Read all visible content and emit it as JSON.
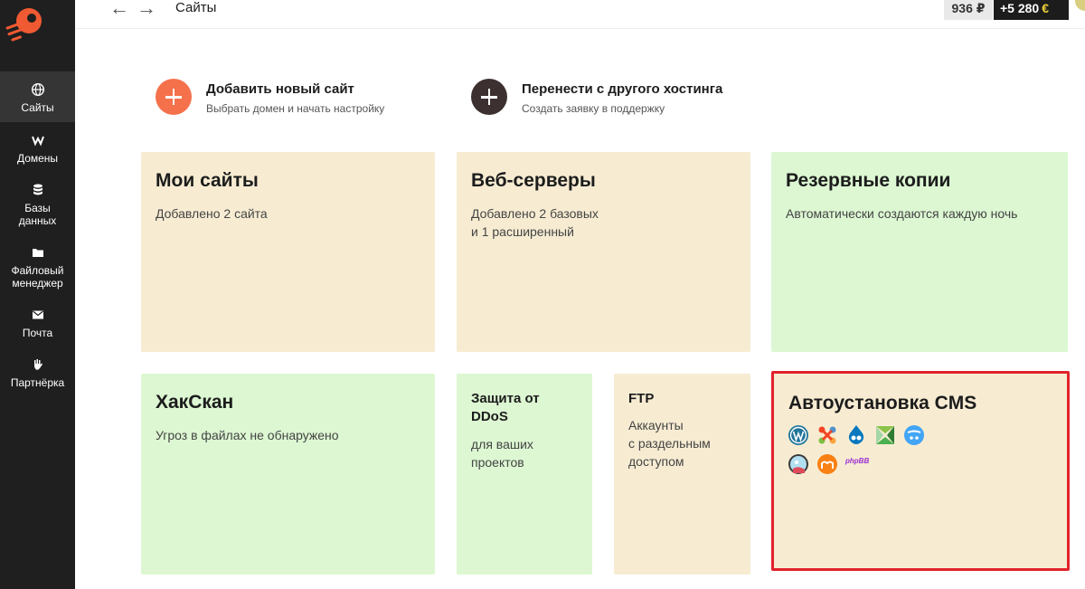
{
  "topbar": {
    "back_icon": "arrow-left-icon",
    "forward_icon": "arrow-right-icon",
    "title": "Сайты",
    "balance": "936 ₽",
    "bonus": "+5 280",
    "bonus_icon": "coin-icon"
  },
  "sidebar": {
    "logo_icon": "rocket-logo-icon",
    "items": [
      {
        "label": "Сайты",
        "icon": "globe-icon",
        "active": true
      },
      {
        "label": "Домены",
        "icon": "domain-w-icon"
      },
      {
        "label": "Базы данных",
        "icon": "database-icon"
      },
      {
        "label": "Файловый менеджер",
        "icon": "folder-icon"
      },
      {
        "label": "Почта",
        "icon": "mail-icon"
      },
      {
        "label": "Партнёрка",
        "icon": "partner-hand-icon"
      }
    ]
  },
  "actions": [
    {
      "title": "Добавить новый сайт",
      "subtitle": "Выбрать домен и начать настройку",
      "color": "#f5714b"
    },
    {
      "title": "Перенести с другого хостинга",
      "subtitle": "Создать заявку в поддержку",
      "color": "#3d3030"
    }
  ],
  "cards": {
    "my_sites": {
      "title": "Мои сайты",
      "desc": "Добавлено 2 сайта"
    },
    "web_servers": {
      "title": "Веб-серверы",
      "desc": "Добавлено 2 базовых\nи 1 расширенный"
    },
    "backups": {
      "title": "Резервные копии",
      "desc": "Автоматически создаются каждую ночь"
    },
    "hackscan": {
      "title": "ХакСкан",
      "desc": "Угроз в файлах не обнаружено"
    },
    "ddos": {
      "title": "Защита от DDoS",
      "desc": "для ваших\nпроектов"
    },
    "ftp": {
      "title": "FTP",
      "desc": "Аккаунты\nс раздельным\nдоступом"
    },
    "cms": {
      "title": "Автоустановка CMS",
      "icons": [
        "wordpress-icon",
        "joomla-icon",
        "drupal-icon",
        "modx-icon",
        "opencart-icon",
        "prestashop-icon",
        "moodle-icon",
        "phpbb-icon"
      ],
      "phpbb_text": "phpBB"
    }
  },
  "colors": {
    "sidebar_bg": "#1f1f1f",
    "accent_orange": "#f5714b",
    "beige_card": "#f7ecd2",
    "green_card": "#dcf7d2",
    "highlight_red": "#e1222c"
  }
}
